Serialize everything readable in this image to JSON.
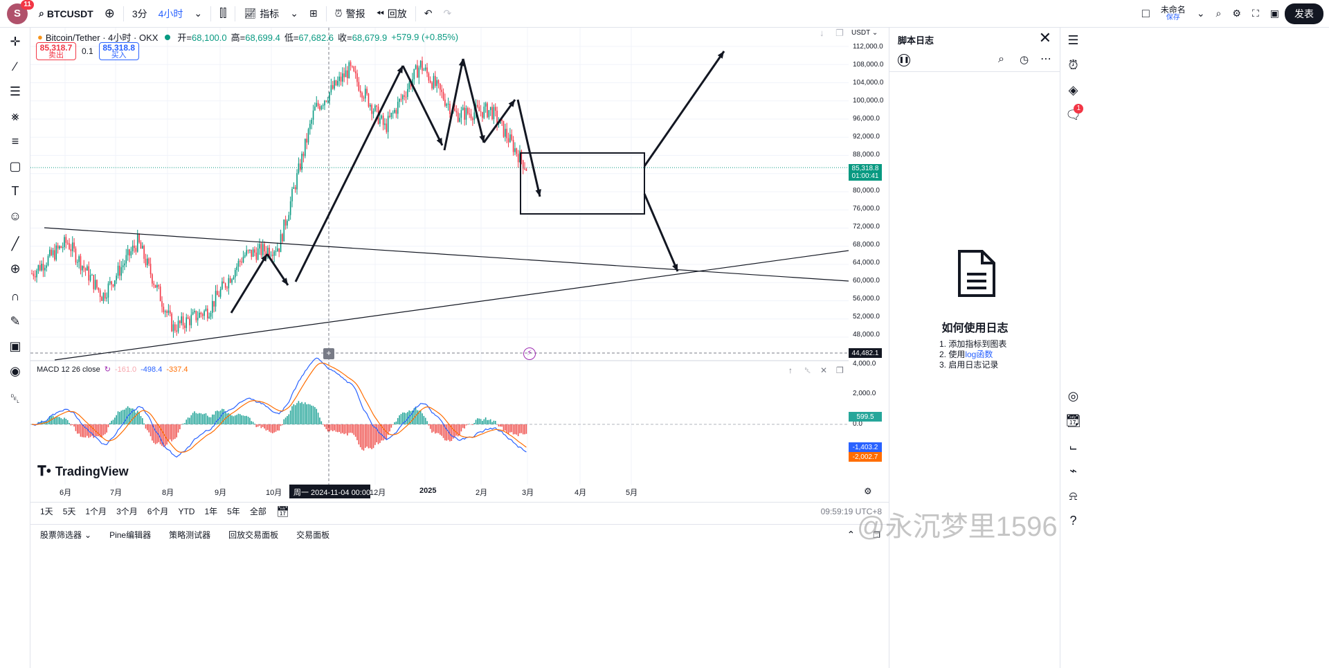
{
  "header": {
    "avatar_letter": "S",
    "avatar_badge": "11",
    "symbol": "BTCUSDT",
    "interval_minutes": "3分",
    "interval_selected": "4小时",
    "indicators": "指标",
    "alert": "警报",
    "replay": "回放",
    "layout_name": "未命名",
    "layout_save": "保存",
    "publish": "发表"
  },
  "legend": {
    "title": "Bitcoin/Tether · 4小时 · OKX",
    "open_label": "开=",
    "open": "68,100.0",
    "high_label": "高=",
    "high": "68,699.4",
    "low_label": "低=",
    "low": "67,682.6",
    "close_label": "收=",
    "close": "68,679.9",
    "change": "+579.9 (+0.85%)"
  },
  "trade": {
    "sell_price": "85,318.7",
    "sell_label": "卖出",
    "spread": "0.1",
    "buy_price": "85,318.8",
    "buy_label": "买入"
  },
  "price_axis": {
    "currency": "USDT",
    "labels": [
      "112,000.0",
      "108,000.0",
      "104,000.0",
      "100,000.0",
      "96,000.0",
      "92,000.0",
      "88,000.0",
      "80,000.0",
      "76,000.0",
      "72,000.0",
      "68,000.0",
      "64,000.0",
      "60,000.0",
      "56,000.0",
      "52,000.0",
      "48,000.0"
    ],
    "last_price": "85,318.8",
    "countdown": "01:00:41",
    "cursor_price": "44,482.1"
  },
  "macd": {
    "title": "MACD 12 26 close",
    "v1": "-161.0",
    "v2": "-498.4",
    "v3": "-337.4",
    "axis_labels": [
      "4,000.0",
      "2,000.0",
      "0.0"
    ],
    "tag_hist": "599.5",
    "tag_macd": "-1,403.2",
    "tag_signal": "-2,002.7"
  },
  "time_axis": {
    "labels": [
      "6月",
      "7月",
      "8月",
      "9月",
      "10月",
      "12月",
      "2025",
      "2月",
      "3月",
      "4月",
      "5月"
    ],
    "cursor": "周一 2024-11-04   00:00"
  },
  "ranges": [
    "1天",
    "5天",
    "1个月",
    "3个月",
    "6个月",
    "YTD",
    "1年",
    "5年",
    "全部"
  ],
  "clock": "09:59:19 UTC+8",
  "bottom_tabs": [
    "股票筛选器",
    "Pine编辑器",
    "策略测试器",
    "回放交易面板",
    "交易面板"
  ],
  "script_log": {
    "title": "脚本日志",
    "how_to": "如何使用日志",
    "step1": "1. 添加指标到图表",
    "step2_prefix": "2. 使用",
    "step2_link": "log函数",
    "step3": "3. 启用日志记录"
  },
  "brand": "TradingView",
  "rightbar_badge": "1",
  "watermark": "@永沉梦里1596",
  "colors": {
    "up": "#089981",
    "down": "#f23645",
    "accent": "#2962ff",
    "macd": "#2962ff",
    "signal": "#ff6d00"
  },
  "chart_data": {
    "type": "candlestick",
    "symbol": "BTCUSDT",
    "timeframe": "4h",
    "approx_close_trend": [
      {
        "t": "2024-05",
        "v": 62000
      },
      {
        "t": "2024-06",
        "v": 69000
      },
      {
        "t": "2024-07",
        "v": 57000
      },
      {
        "t": "2024-07-28",
        "v": 69000
      },
      {
        "t": "2024-08-05",
        "v": 50000
      },
      {
        "t": "2024-09",
        "v": 54000
      },
      {
        "t": "2024-10",
        "v": 66000
      },
      {
        "t": "2024-11-04",
        "v": 68000
      },
      {
        "t": "2024-11-20",
        "v": 98000
      },
      {
        "t": "2024-12-17",
        "v": 107000
      },
      {
        "t": "2025-01-01",
        "v": 94000
      },
      {
        "t": "2025-01-20",
        "v": 108000
      },
      {
        "t": "2025-02-05",
        "v": 97000
      },
      {
        "t": "2025-02-20",
        "v": 98000
      },
      {
        "t": "2025-03-01",
        "v": 85300
      }
    ],
    "ylim": [
      44000,
      113000
    ]
  }
}
